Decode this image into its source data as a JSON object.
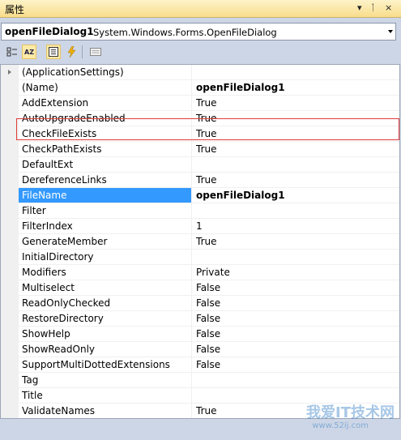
{
  "window": {
    "title": "属性",
    "controls": {
      "dropdown": "▾",
      "pin": "ᛙ",
      "close": "×"
    }
  },
  "object_selector": {
    "name": "openFileDialog1",
    "type": "System.Windows.Forms.OpenFileDialog"
  },
  "toolbar": {
    "buttons": [
      {
        "icon": "categorized-icon"
      },
      {
        "icon": "alphabetical-icon",
        "label": "AZ"
      },
      {
        "icon": "properties-icon"
      },
      {
        "icon": "events-icon"
      },
      {
        "icon": "property-pages-icon"
      }
    ]
  },
  "properties": [
    {
      "name": "(ApplicationSettings)",
      "value": ""
    },
    {
      "name": "(Name)",
      "value": "openFileDialog1"
    },
    {
      "name": "AddExtension",
      "value": "True"
    },
    {
      "name": "AutoUpgradeEnabled",
      "value": "True"
    },
    {
      "name": "CheckFileExists",
      "value": "True"
    },
    {
      "name": "CheckPathExists",
      "value": "True"
    },
    {
      "name": "DefaultExt",
      "value": ""
    },
    {
      "name": "DereferenceLinks",
      "value": "True"
    },
    {
      "name": "FileName",
      "value": "openFileDialog1"
    },
    {
      "name": "Filter",
      "value": ""
    },
    {
      "name": "FilterIndex",
      "value": "1"
    },
    {
      "name": "GenerateMember",
      "value": "True"
    },
    {
      "name": "InitialDirectory",
      "value": ""
    },
    {
      "name": "Modifiers",
      "value": "Private"
    },
    {
      "name": "Multiselect",
      "value": "False"
    },
    {
      "name": "ReadOnlyChecked",
      "value": "False"
    },
    {
      "name": "RestoreDirectory",
      "value": "False"
    },
    {
      "name": "ShowHelp",
      "value": "False"
    },
    {
      "name": "ShowReadOnly",
      "value": "False"
    },
    {
      "name": "SupportMultiDottedExtensions",
      "value": "False"
    },
    {
      "name": "Tag",
      "value": ""
    },
    {
      "name": "Title",
      "value": ""
    },
    {
      "name": "ValidateNames",
      "value": "True"
    }
  ],
  "selected_property": "FileName",
  "watermark": {
    "text": "我爱IT技术网",
    "url": "www.52ij.com"
  },
  "colors": {
    "selection": "#3399ff",
    "highlight_box": "#e23a3a",
    "title_bar": "#f8dd8a"
  }
}
